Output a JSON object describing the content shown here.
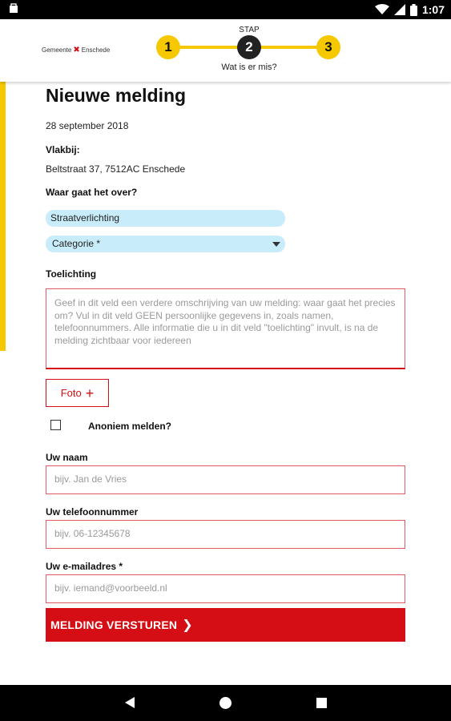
{
  "status_bar": {
    "time": "1:07"
  },
  "header": {
    "logo_text_left": "Gemeente",
    "logo_text_right": "Enschede",
    "stepper": {
      "label": "STAP",
      "steps": [
        "1",
        "2",
        "3"
      ],
      "current": 2,
      "caption": "Wat is er mis?"
    }
  },
  "form": {
    "title": "Nieuwe melding",
    "date": "28 september 2018",
    "nearby_label": "Vlakbij:",
    "address": "Beltstraat 37, 7512AC Enschede",
    "subject_label": "Waar gaat het over?",
    "subject_value": "Straatverlichting",
    "category_placeholder": "Categorie *",
    "description_label": "Toelichting",
    "description_placeholder": "Geef in dit veld een verdere omschrijving van uw melding: waar gaat het precies om? Vul in dit veld GEEN persoonlijke gegevens in, zoals namen, telefoonnummers. Alle informatie die u in dit veld \"toelichting\" invult, is na de melding zichtbaar voor iedereen",
    "photo_button": "Foto",
    "anonymous_label": "Anoniem melden?",
    "name_label": "Uw naam",
    "name_placeholder": "bijv. Jan de Vries",
    "phone_label": "Uw telefoonnummer",
    "phone_placeholder": "bijv. 06-12345678",
    "email_label": "Uw e-mailadres *",
    "email_placeholder": "bijv. iemand@voorbeeld.nl",
    "submit_label": "MELDING VERSTUREN"
  },
  "colors": {
    "accent_yellow": "#f5c800",
    "brand_red": "#d40e14",
    "pill_blue": "#c9ecfb"
  }
}
